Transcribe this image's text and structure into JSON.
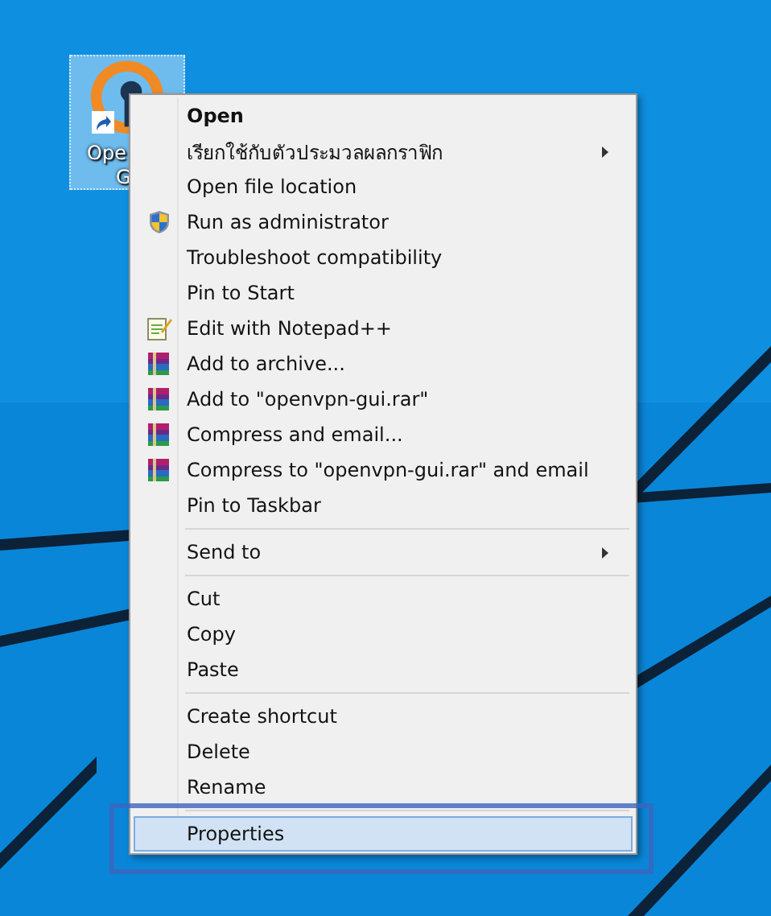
{
  "desktop_icon": {
    "label_lines": [
      "Ope",
      "G"
    ],
    "selected": true,
    "shortcut": true
  },
  "context_menu": {
    "items": [
      {
        "kind": "item",
        "label": "Open",
        "bold": true,
        "submenu": false,
        "selected": false
      },
      {
        "kind": "item",
        "label": "เรียกใช้กับตัวประมวลผลกราฟิก",
        "bold": false,
        "submenu": true,
        "selected": false
      },
      {
        "kind": "item",
        "label": "Open file location",
        "bold": false,
        "submenu": false,
        "selected": false
      },
      {
        "kind": "shield",
        "label": "Run as administrator",
        "bold": false,
        "submenu": false,
        "selected": false
      },
      {
        "kind": "item",
        "label": "Troubleshoot compatibility",
        "bold": false,
        "submenu": false,
        "selected": false
      },
      {
        "kind": "item",
        "label": "Pin to Start",
        "bold": false,
        "submenu": false,
        "selected": false
      },
      {
        "kind": "notepad",
        "label": "Edit with Notepad++",
        "bold": false,
        "submenu": false,
        "selected": false
      },
      {
        "kind": "archive",
        "label": "Add to archive...",
        "bold": false,
        "submenu": false,
        "selected": false
      },
      {
        "kind": "archive",
        "label": "Add to \"openvpn-gui.rar\"",
        "bold": false,
        "submenu": false,
        "selected": false
      },
      {
        "kind": "archive",
        "label": "Compress and email...",
        "bold": false,
        "submenu": false,
        "selected": false
      },
      {
        "kind": "archive",
        "label": "Compress to \"openvpn-gui.rar\" and email",
        "bold": false,
        "submenu": false,
        "selected": false
      },
      {
        "kind": "item",
        "label": "Pin to Taskbar",
        "bold": false,
        "submenu": false,
        "selected": false
      },
      {
        "kind": "separator"
      },
      {
        "kind": "item",
        "label": "Send to",
        "bold": false,
        "submenu": true,
        "selected": false
      },
      {
        "kind": "separator"
      },
      {
        "kind": "item",
        "label": "Cut",
        "bold": false,
        "submenu": false,
        "selected": false
      },
      {
        "kind": "item",
        "label": "Copy",
        "bold": false,
        "submenu": false,
        "selected": false
      },
      {
        "kind": "item",
        "label": "Paste",
        "bold": false,
        "submenu": false,
        "selected": false
      },
      {
        "kind": "separator"
      },
      {
        "kind": "item",
        "label": "Create shortcut",
        "bold": false,
        "submenu": false,
        "selected": false
      },
      {
        "kind": "item",
        "label": "Delete",
        "bold": false,
        "submenu": false,
        "selected": false
      },
      {
        "kind": "item",
        "label": "Rename",
        "bold": false,
        "submenu": false,
        "selected": false
      },
      {
        "kind": "separator"
      },
      {
        "kind": "item",
        "label": "Properties",
        "bold": false,
        "submenu": false,
        "selected": true,
        "highlighted": true
      }
    ]
  }
}
